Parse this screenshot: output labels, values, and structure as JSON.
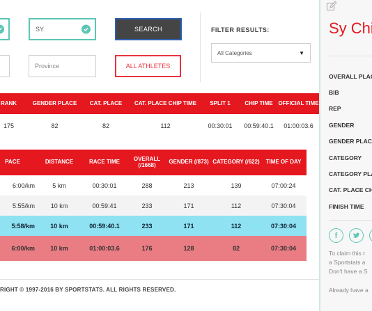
{
  "search": {
    "field1_value": "",
    "field2_value": "SY",
    "province_placeholder": "Province",
    "search_label": "SEARCH",
    "all_athletes_label": "ALL ATHLETES",
    "filter_label": "FILTER RESULTS:",
    "category_selected": "All Categories"
  },
  "overall_table": {
    "headers": [
      "RANK",
      "GENDER PLACE",
      "CAT. PLACE",
      "CAT. PLACE CHIP TIME",
      "SPLIT 1",
      "CHIP TIME",
      "OFFICIAL TIME"
    ],
    "row": [
      "175",
      "82",
      "82",
      "112",
      "00:30:01",
      "00:59:40.1",
      "01:00:03.6"
    ]
  },
  "splits_table": {
    "headers": [
      "PACE",
      "DISTANCE",
      "RACE TIME",
      "OVERALL (/1668)",
      "GENDER (/873)",
      "CATEGORY (/622)",
      "TIME OF DAY"
    ],
    "rows": [
      [
        "6:00/km",
        "5 km",
        "00:30:01",
        "288",
        "213",
        "139",
        "07:00:24"
      ],
      [
        "5:55/km",
        "10 km",
        "00:59:41",
        "233",
        "171",
        "112",
        "07:30:04"
      ],
      [
        "5:58/km",
        "10 km",
        "00:59:40.1",
        "233",
        "171",
        "112",
        "07:30:04"
      ],
      [
        "6:00/km",
        "10 km",
        "01:00:03.6",
        "176",
        "128",
        "82",
        "07:30:04"
      ]
    ]
  },
  "footer": {
    "copyright": "RIGHT © 1997-2016 BY SPORTSTATS. ALL RIGHTS RESERVED."
  },
  "sidebar": {
    "name": "Sy Chi",
    "fields": [
      "OVERALL PLACE",
      "BIB",
      "REP",
      "GENDER",
      "GENDER PLACE",
      "CATEGORY",
      "CATEGORY PLACE",
      "CAT. PLACE CHIP TIME",
      "FINISH TIME"
    ],
    "claim_lines": [
      "To claim this r",
      "a Sportstats a",
      "Don't have a S"
    ],
    "already": "Already have a",
    "icons": [
      "pencil-icon",
      "facebook-icon",
      "twitter-icon"
    ]
  },
  "colors": {
    "accent": "#e5171f",
    "teal": "#5cc6b6",
    "highlight": "#8ee2f2",
    "official": "#ea7d83"
  }
}
